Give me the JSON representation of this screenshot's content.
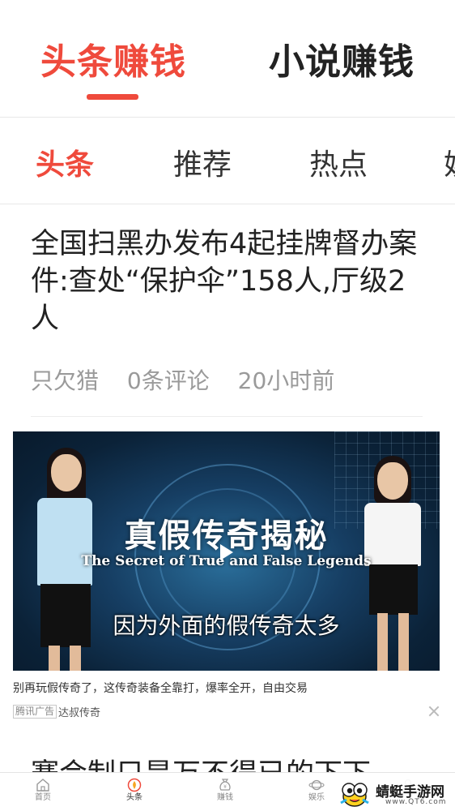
{
  "colors": {
    "accent": "#ef4a3c",
    "text": "#222222",
    "muted": "#9a9a9a"
  },
  "top_tabs": [
    {
      "label": "头条赚钱",
      "active": true
    },
    {
      "label": "小说赚钱",
      "active": false
    }
  ],
  "categories": [
    {
      "label": "头条",
      "active": true
    },
    {
      "label": "推荐",
      "active": false
    },
    {
      "label": "热点",
      "active": false
    },
    {
      "label": "娱",
      "active": false
    }
  ],
  "article": {
    "title": "全国扫黑办发布4起挂牌督办案件:查处“保护伞”158人,厅级2人",
    "author": "只欠猎",
    "comments": "0条评论",
    "time": "20小时前"
  },
  "ad": {
    "video_title": "真假传奇揭秘",
    "video_subtitle": "The Secret of True and False Legends",
    "video_caption": "因为外面的假传奇太多",
    "description": "别再玩假传奇了，这传奇装备全靠打，爆率全开，自由交易",
    "badge": "腾讯广告",
    "source": "达叔传奇",
    "play_icon": "play-icon",
    "close_icon": "close-icon"
  },
  "next_article": {
    "title_partial": "赛会制只是万不得已的下下"
  },
  "bottom_nav": [
    {
      "label": "首页",
      "icon": "home-icon",
      "active": false
    },
    {
      "label": "头条",
      "icon": "headline-icon",
      "active": true
    },
    {
      "label": "赚钱",
      "icon": "money-bag-icon",
      "active": false
    },
    {
      "label": "娱乐",
      "icon": "planet-icon",
      "active": false
    },
    {
      "label": "",
      "icon": "user-icon",
      "active": false
    }
  ],
  "watermark": {
    "name": "蜻蜓手游网",
    "url": "www.QT6.com"
  }
}
